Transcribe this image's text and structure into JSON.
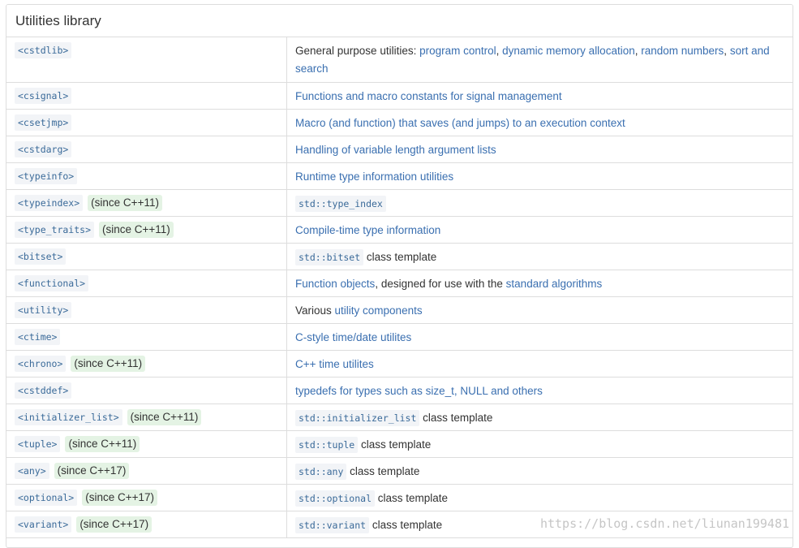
{
  "title": "Utilities library",
  "rows": [
    {
      "header": "<cstdlib>",
      "since": "",
      "desc": [
        {
          "t": "General purpose utilities: ",
          "k": "text"
        },
        {
          "t": "program control",
          "k": "link"
        },
        {
          "t": ", ",
          "k": "text"
        },
        {
          "t": "dynamic memory allocation",
          "k": "link"
        },
        {
          "t": ", ",
          "k": "text"
        },
        {
          "t": "random numbers",
          "k": "link"
        },
        {
          "t": ", ",
          "k": "text"
        },
        {
          "t": "sort and search",
          "k": "link"
        }
      ]
    },
    {
      "header": "<csignal>",
      "since": "",
      "desc": [
        {
          "t": "Functions and macro constants for signal management",
          "k": "link"
        }
      ]
    },
    {
      "header": "<csetjmp>",
      "since": "",
      "desc": [
        {
          "t": "Macro (and function) that saves (and jumps) to an execution context",
          "k": "link"
        }
      ]
    },
    {
      "header": "<cstdarg>",
      "since": "",
      "desc": [
        {
          "t": "Handling of variable length argument lists",
          "k": "link"
        }
      ]
    },
    {
      "header": "<typeinfo>",
      "since": "",
      "desc": [
        {
          "t": "Runtime type information utilities",
          "k": "link"
        }
      ]
    },
    {
      "header": "<typeindex>",
      "since": "(since C++11)",
      "desc": [
        {
          "t": "std::type_index",
          "k": "code"
        }
      ]
    },
    {
      "header": "<type_traits>",
      "since": "(since C++11)",
      "desc": [
        {
          "t": "Compile-time type information",
          "k": "link"
        }
      ]
    },
    {
      "header": "<bitset>",
      "since": "",
      "desc": [
        {
          "t": "std::bitset",
          "k": "code"
        },
        {
          "t": " class template",
          "k": "text"
        }
      ]
    },
    {
      "header": "<functional>",
      "since": "",
      "desc": [
        {
          "t": "Function objects",
          "k": "link"
        },
        {
          "t": ", designed for use with the ",
          "k": "text"
        },
        {
          "t": "standard algorithms",
          "k": "link"
        }
      ]
    },
    {
      "header": "<utility>",
      "since": "",
      "desc": [
        {
          "t": "Various ",
          "k": "text"
        },
        {
          "t": "utility components",
          "k": "link"
        }
      ]
    },
    {
      "header": "<ctime>",
      "since": "",
      "desc": [
        {
          "t": "C-style time/date utilites",
          "k": "link"
        }
      ]
    },
    {
      "header": "<chrono>",
      "since": "(since C++11)",
      "desc": [
        {
          "t": "C++ time utilites",
          "k": "link"
        }
      ]
    },
    {
      "header": "<cstddef>",
      "since": "",
      "desc": [
        {
          "t": "typedefs for types such as size_t, NULL and others",
          "k": "link"
        }
      ]
    },
    {
      "header": "<initializer_list>",
      "since": "(since C++11)",
      "desc": [
        {
          "t": "std::initializer_list",
          "k": "code"
        },
        {
          "t": " class template",
          "k": "text"
        }
      ]
    },
    {
      "header": "<tuple>",
      "since": "(since C++11)",
      "desc": [
        {
          "t": "std::tuple",
          "k": "code"
        },
        {
          "t": " class template",
          "k": "text"
        }
      ]
    },
    {
      "header": "<any>",
      "since": "(since C++17)",
      "desc": [
        {
          "t": "std::any",
          "k": "code"
        },
        {
          "t": " class template",
          "k": "text"
        }
      ]
    },
    {
      "header": "<optional>",
      "since": "(since C++17)",
      "desc": [
        {
          "t": "std::optional",
          "k": "code"
        },
        {
          "t": " class template",
          "k": "text"
        }
      ]
    },
    {
      "header": "<variant>",
      "since": "(since C++17)",
      "desc": [
        {
          "t": "std::variant",
          "k": "code"
        },
        {
          "t": " class template",
          "k": "text"
        }
      ]
    }
  ],
  "watermark": "https://blog.csdn.net/liunan199481"
}
